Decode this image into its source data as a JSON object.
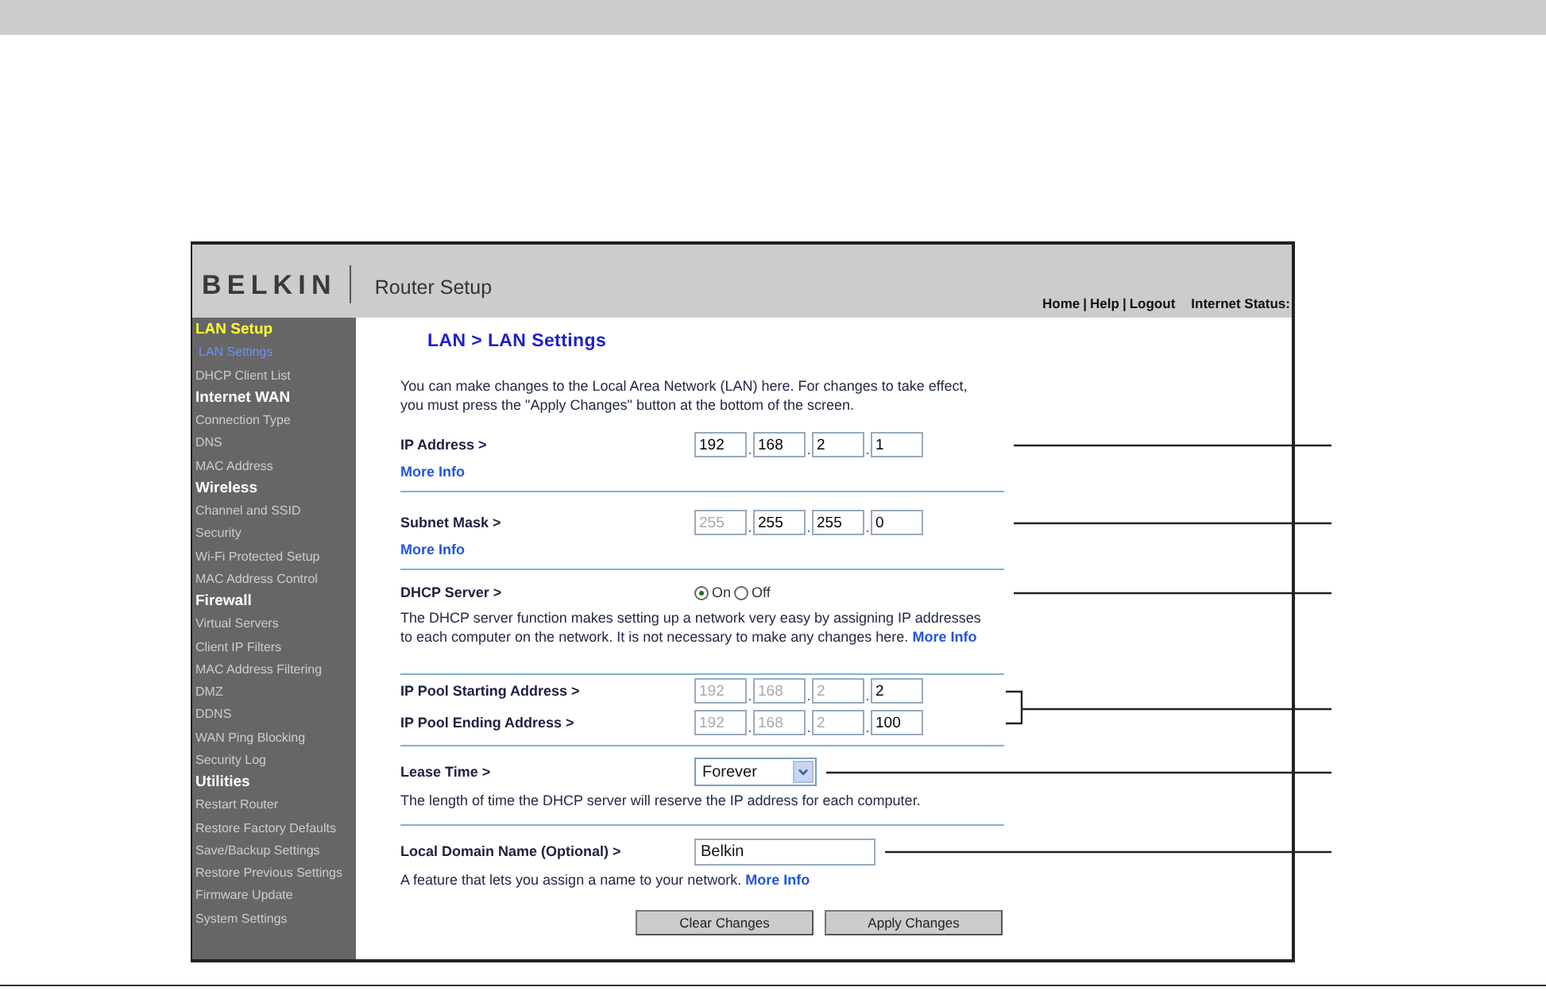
{
  "screenshot": {
    "brand": "BELKIN",
    "app_title": "Router Setup",
    "top_links": [
      "Home",
      "Help",
      "Logout"
    ],
    "link_separator": "|",
    "internet_status": "Internet Status:",
    "sidebar": [
      {
        "label": "LAN Setup",
        "kind": "heading",
        "selected": true
      },
      {
        "label": "LAN Settings",
        "kind": "item",
        "selected": true
      },
      {
        "label": "DHCP Client List",
        "kind": "item",
        "selected": false
      },
      {
        "label": "Internet WAN",
        "kind": "heading",
        "selected": false
      },
      {
        "label": "Connection Type",
        "kind": "item",
        "selected": false
      },
      {
        "label": "DNS",
        "kind": "item",
        "selected": false
      },
      {
        "label": "MAC Address",
        "kind": "item",
        "selected": false
      },
      {
        "label": "Wireless",
        "kind": "heading",
        "selected": false
      },
      {
        "label": "Channel and SSID",
        "kind": "item",
        "selected": false
      },
      {
        "label": "Security",
        "kind": "item",
        "selected": false
      },
      {
        "label": "Wi-Fi Protected Setup",
        "kind": "item",
        "selected": false
      },
      {
        "label": "MAC Address Control",
        "kind": "item",
        "selected": false
      },
      {
        "label": "Firewall",
        "kind": "heading",
        "selected": false
      },
      {
        "label": "Virtual Servers",
        "kind": "item",
        "selected": false
      },
      {
        "label": "Client IP Filters",
        "kind": "item",
        "selected": false
      },
      {
        "label": "MAC Address Filtering",
        "kind": "item",
        "selected": false
      },
      {
        "label": "DMZ",
        "kind": "item",
        "selected": false
      },
      {
        "label": "DDNS",
        "kind": "item",
        "selected": false
      },
      {
        "label": "WAN Ping Blocking",
        "kind": "item",
        "selected": false
      },
      {
        "label": "Security Log",
        "kind": "item",
        "selected": false
      },
      {
        "label": "Utilities",
        "kind": "heading",
        "selected": false
      },
      {
        "label": "Restart Router",
        "kind": "item",
        "selected": false
      },
      {
        "label": "Restore Factory Defaults",
        "kind": "item",
        "selected": false
      },
      {
        "label": "Save/Backup Settings",
        "kind": "item",
        "selected": false
      },
      {
        "label": "Restore Previous Settings",
        "kind": "item",
        "selected": false
      },
      {
        "label": "Firmware Update",
        "kind": "item",
        "selected": false
      },
      {
        "label": "System Settings",
        "kind": "item",
        "selected": false
      }
    ],
    "page_title": "LAN > LAN Settings",
    "intro": "You can make changes to the Local Area Network (LAN) here. For changes to take effect, you must press the \"Apply Changes\" button at the bottom of the screen.",
    "octet_separator": ".",
    "sections": [
      {
        "kind": "ip",
        "label": "IP Address >",
        "octets": [
          {
            "value": "192",
            "disabled": false
          },
          {
            "value": "168",
            "disabled": false
          },
          {
            "value": "2",
            "disabled": false
          },
          {
            "value": "1",
            "disabled": false
          }
        ],
        "link": "More Info"
      },
      {
        "kind": "ip",
        "label": "Subnet Mask >",
        "octets": [
          {
            "value": "255",
            "disabled": true
          },
          {
            "value": "255",
            "disabled": false
          },
          {
            "value": "255",
            "disabled": false
          },
          {
            "value": "0",
            "disabled": false
          }
        ],
        "link": "More Info"
      },
      {
        "kind": "radio",
        "label": "DHCP Server  >",
        "options": [
          {
            "label": "On",
            "selected": true
          },
          {
            "label": "Off",
            "selected": false
          }
        ],
        "description": "The DHCP server function makes setting up a network very easy by assigning IP addresses to each computer on the network. It is not necessary to make any changes here.",
        "link": "More Info"
      },
      {
        "kind": "ip_pair",
        "rows": [
          {
            "label": "IP Pool Starting Address >",
            "octets": [
              {
                "value": "192",
                "disabled": true
              },
              {
                "value": "168",
                "disabled": true
              },
              {
                "value": "2",
                "disabled": true
              },
              {
                "value": "2",
                "disabled": false
              }
            ]
          },
          {
            "label": "IP Pool Ending Address >",
            "octets": [
              {
                "value": "192",
                "disabled": true
              },
              {
                "value": "168",
                "disabled": true
              },
              {
                "value": "2",
                "disabled": true
              },
              {
                "value": "100",
                "disabled": false
              }
            ]
          }
        ]
      },
      {
        "kind": "select",
        "label": "Lease Time >",
        "value": "Forever",
        "description": "The length of time the DHCP server will reserve the IP address for each computer."
      },
      {
        "kind": "text",
        "label": "Local Domain Name  (Optional) >",
        "value": "Belkin",
        "description": "A feature that lets you assign a name to your network.",
        "link": "More Info"
      }
    ],
    "buttons": [
      "Clear Changes",
      "Apply Changes"
    ]
  }
}
